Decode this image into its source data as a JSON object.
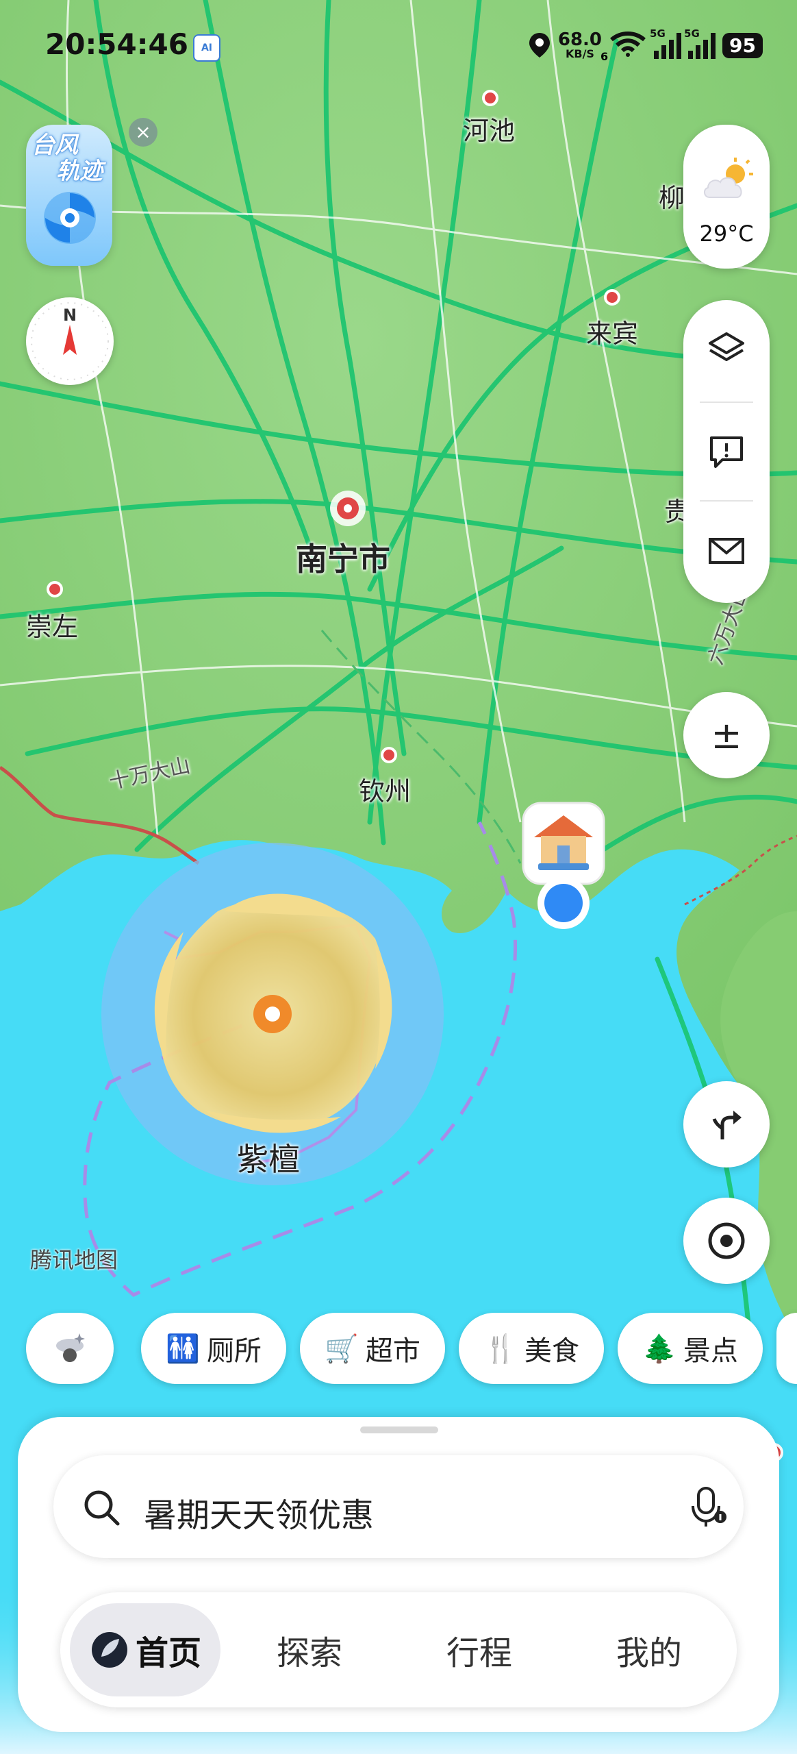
{
  "status_bar": {
    "time": "20:54:46",
    "ai_badge": "AI",
    "net_speed_value": "68.0",
    "net_speed_unit": "KB/S",
    "wifi_tag": "6",
    "sim1_tag": "5G",
    "sim2_tag": "5G",
    "battery": "95"
  },
  "map": {
    "place_labels": {
      "hechi": "河池",
      "liuzhou": "柳",
      "laibin": "来宾",
      "nanning": "南宁市",
      "guigang": "贵港",
      "chongzuo": "崇左",
      "shiwandashan": "十万大山",
      "qinzhou": "钦州",
      "mountain_right": "六万大山"
    },
    "typhoon_name": "紫檀",
    "watermark": "腾讯地图",
    "colors": {
      "land": "#8fd27a",
      "sea": "#46dcf6",
      "road": "#19c46f",
      "typhoon_core": "#f2d98a",
      "typhoon_radius": "#7fc2f7",
      "track": "#a78be8"
    }
  },
  "typhoon_button": {
    "line1": "台风",
    "line2": "轨迹",
    "close_icon": "close-icon"
  },
  "weather": {
    "icon": "partly-cloudy-icon",
    "temperature": "29°C"
  },
  "right_tools": {
    "layers_icon": "layers-icon",
    "feedback_icon": "feedback-icon",
    "message_icon": "mail-icon",
    "scale_icon": "plus-minus-icon",
    "scale_text": "±",
    "route_icon": "route-icon",
    "locate_icon": "locate-icon"
  },
  "chips": [
    {
      "label": "厕所",
      "icon": "toilet-icon"
    },
    {
      "label": "超市",
      "icon": "cart-icon"
    },
    {
      "label": "美食",
      "icon": "food-icon"
    },
    {
      "label": "景点",
      "icon": "tree-icon"
    }
  ],
  "search": {
    "placeholder": "暑期天天领优惠",
    "voice_icon": "microphone-icon"
  },
  "bottom_nav": [
    {
      "label": "首页",
      "active": true
    },
    {
      "label": "探索",
      "active": false
    },
    {
      "label": "行程",
      "active": false
    },
    {
      "label": "我的",
      "active": false
    }
  ]
}
